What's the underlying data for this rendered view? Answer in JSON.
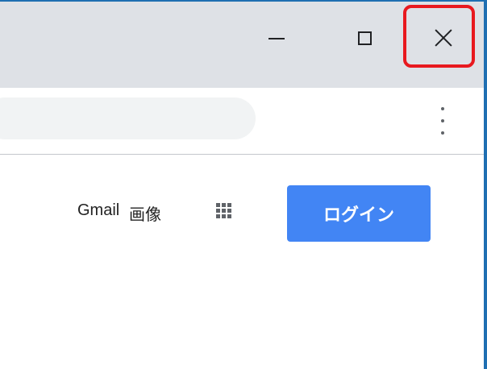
{
  "window_controls": {
    "minimize_icon": "minimize-icon",
    "maximize_icon": "maximize-icon",
    "close_icon": "close-icon"
  },
  "toolbar": {
    "menu_icon": "kebab-menu-icon"
  },
  "header_links": {
    "gmail": "Gmail",
    "images": "画像",
    "apps_icon": "apps-grid-icon",
    "login": "ログイン"
  },
  "colors": {
    "titlebar": "#dee1e6",
    "login_button": "#4285f4",
    "highlight": "#e8191f",
    "frame_border": "#1f6fb2"
  }
}
